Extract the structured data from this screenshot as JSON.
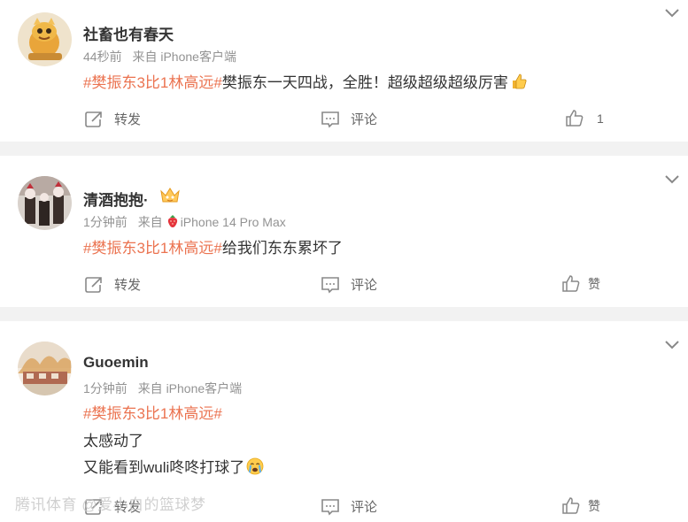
{
  "comments": [
    {
      "user": "社畜也有春天",
      "time": "44秒前",
      "source": "来自 iPhone客户端",
      "topic": "#樊振东3比1林高远#",
      "text": "樊振东一天四战，全胜！超级超级超级厉害",
      "emoji": "thumbs-up-emoji",
      "repost_label": "转发",
      "comment_label": "评论",
      "like_count": "1"
    },
    {
      "user": "清酒抱抱·",
      "time": "1分钟前",
      "source_prefix": "来自",
      "source_device": "iPhone 14 Pro Max",
      "topic": "#樊振东3比1林高远#",
      "text": "给我们东东累坏了",
      "repost_label": "转发",
      "comment_label": "评论",
      "like_label": "赞"
    },
    {
      "user": "Guoemin",
      "time": "1分钟前",
      "source": "来自 iPhone客户端",
      "topic": "#樊振东3比1林高远#",
      "line1": "太感动了",
      "line2": "又能看到wuli咚咚打球了",
      "emoji": "crying-emoji",
      "repost_label": "转发",
      "comment_label": "评论",
      "like_label": "赞"
    }
  ],
  "watermark": "腾讯体育 @爱小白的篮球梦",
  "colors": {
    "topic": "#eb7350",
    "meta": "#939393",
    "background": "#f2f2f2"
  }
}
